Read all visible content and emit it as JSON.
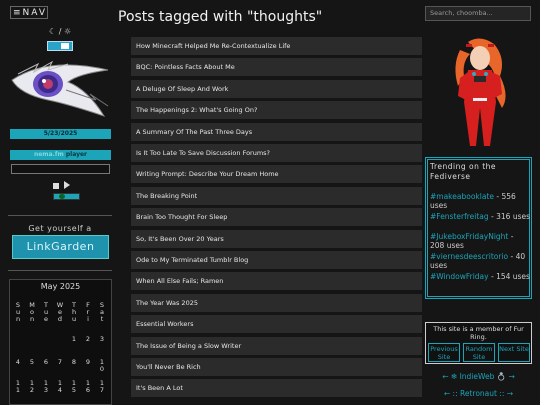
{
  "nav": {
    "label": "NAV",
    "menu_icon": "hamburger-icon"
  },
  "theme": {
    "label": "☾ / ☼"
  },
  "date": "5/23/2025",
  "player": {
    "prefix": "nema.fm",
    "suffix": " player"
  },
  "linkgarden": {
    "text": "Get yourself a",
    "button": "LinkGarden"
  },
  "calendar": {
    "title": "May 2025",
    "weekdays": [
      [
        "S",
        "u",
        "n"
      ],
      [
        "M",
        "o",
        "n"
      ],
      [
        "T",
        "u",
        "e"
      ],
      [
        "W",
        "e",
        "d"
      ],
      [
        "T",
        "h",
        "u"
      ],
      [
        "F",
        "r",
        "i"
      ],
      [
        "S",
        "a",
        "t"
      ]
    ],
    "rows": [
      [
        "",
        "",
        "",
        "",
        "1",
        "2",
        "3"
      ],
      [
        "4",
        "5",
        "6",
        "7",
        "8",
        "9",
        "10"
      ],
      [
        "11",
        "12",
        "13",
        "14",
        "15",
        "16",
        "17"
      ]
    ]
  },
  "page": {
    "title": "Posts tagged with \"thoughts\""
  },
  "posts": [
    "How Minecraft Helped Me Re-Contextualize Life",
    "BQC: Pointless Facts About Me",
    "A Deluge Of Sleep And Work",
    "The Happenings 2: What's Going On?",
    "A Summary Of The Past Three Days",
    "Is It Too Late To Save Discussion Forums?",
    "Writing Prompt: Describe Your Dream Home",
    "The Breaking Point",
    "Brain Too Thought For Sleep",
    "So, It's Been Over 20 Years",
    "Ode to My Terminated Tumblr Blog",
    "When All Else Fails; Ramen",
    "The Year Was 2025",
    "Essential Workers",
    "The Issue of Being a Slow Writer",
    "You'll Never Be Rich",
    "It's Been A Lot"
  ],
  "search": {
    "placeholder": "Search, choomba..."
  },
  "trending": {
    "title": "Trending on the Fediverse",
    "items": [
      {
        "tag": "#makeabooklate",
        "count": " - 556 uses"
      },
      {
        "tag": "#Fensterfreitag",
        "count": " - 316 uses"
      },
      {
        "tag": "#JukeboxFridayNight",
        "count": " - 208 uses"
      },
      {
        "tag": "#viernesdeescritorio",
        "count": " - 40 uses"
      },
      {
        "tag": "#WindowFriday",
        "count": " - 154 uses"
      }
    ]
  },
  "webring": {
    "title": "This site is a member of Fur Ring.",
    "prev": "Previous Site",
    "random": "Random Site",
    "next": "Next Site"
  },
  "badges": {
    "indieweb": "← ❄ IndieWeb 💍 →",
    "retronaut": "← :: Retronaut :: →"
  },
  "colors": {
    "accent": "#1ca4b8",
    "background": "#151515",
    "post_bg": "#2b2b2b"
  }
}
